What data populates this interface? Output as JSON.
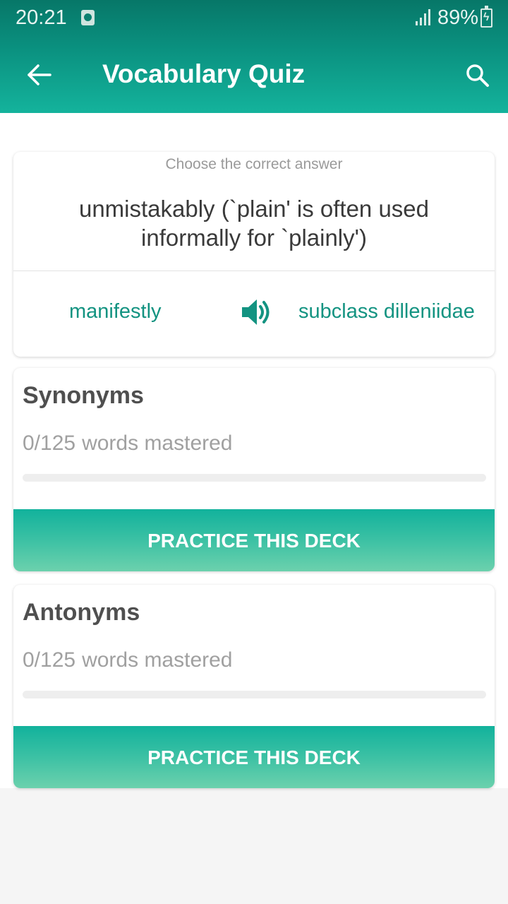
{
  "status_bar": {
    "time": "20:21",
    "battery": "89%",
    "icons": [
      "clock-icon",
      "signal-icon",
      "battery-charging-icon"
    ]
  },
  "toolbar": {
    "title": "Vocabulary Quiz",
    "back_icon": "arrow-left-icon",
    "search_icon": "search-icon"
  },
  "quiz": {
    "instruction": "Choose the correct answer",
    "question": "unmistakably (`plain' is often used informally for `plainly')",
    "options": [
      "manifestly",
      "subclass dilleniidae"
    ],
    "speaker_icon": "speaker-icon"
  },
  "decks": [
    {
      "title": "Synonyms",
      "mastered": "0/125",
      "mastered_suffix": "words mastered",
      "progress_fraction": 0,
      "button_label": "PRACTICE THIS DECK"
    },
    {
      "title": "Antonyms",
      "mastered": "0/125",
      "mastered_suffix": "words mastered",
      "progress_fraction": 0,
      "button_label": "PRACTICE THIS DECK"
    }
  ],
  "colors": {
    "accent": "#0a8f7e",
    "option_text": "#139381",
    "button_gradient_top": "#12b29c",
    "button_gradient_bottom": "#6cd1ad"
  }
}
